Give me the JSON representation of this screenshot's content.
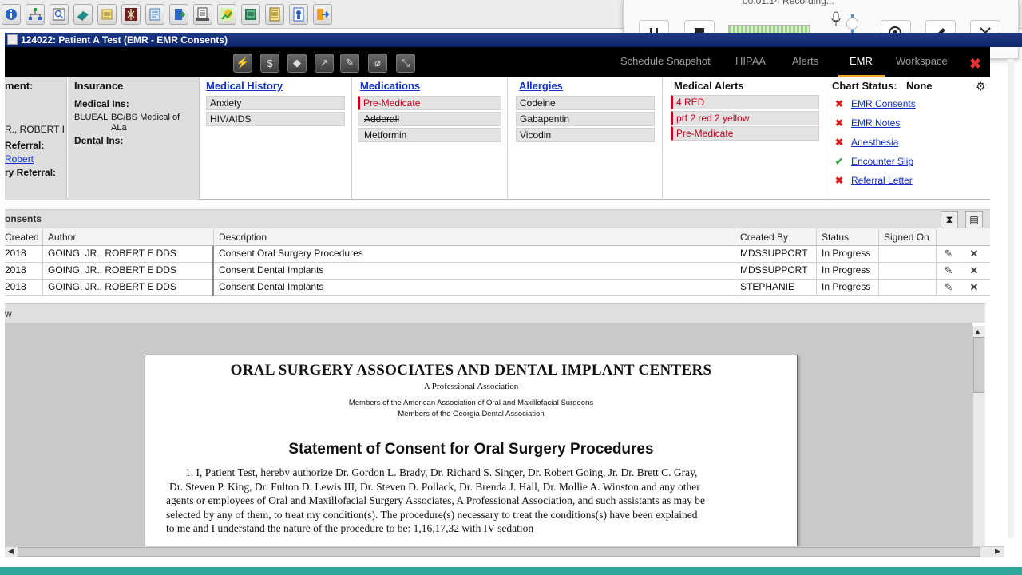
{
  "recorder": {
    "status": "00:01:14 Recording...",
    "buttons": [
      "pause-icon",
      "stop-icon",
      "webcam-icon",
      "pen-icon",
      "close-icon"
    ]
  },
  "toolbar_icons": [
    "info-icon",
    "org-chart-icon",
    "search-icon",
    "book-icon",
    "scroll-icon",
    "caduceus-icon",
    "form-icon",
    "exit-door-icon",
    "scanner-icon",
    "chart-icon",
    "ledger-icon",
    "binder-icon",
    "tooth-doc-icon",
    "logout-icon"
  ],
  "window": {
    "title": "124022: Patient A Test (EMR - EMR Consents)"
  },
  "nav": {
    "tabs": [
      {
        "label": "Schedule Snapshot"
      },
      {
        "label": "HIPAA"
      },
      {
        "label": "Alerts"
      },
      {
        "label": "EMR"
      },
      {
        "label": "Workspace"
      }
    ],
    "active_tab": "EMR",
    "accent_color": "#f2a52a"
  },
  "summary": {
    "left_partial": {
      "heading": "ment:",
      "doctor": "R., ROBERT I",
      "referral_label": "Referral:",
      "referral_link": "Robert",
      "secondary_referral_label": "ry Referral:"
    },
    "insurance": {
      "heading": "Insurance",
      "medical_label": "Medical Ins:",
      "medical_code": "BLUEAL",
      "medical_name_1": "BC/BS Medical of",
      "medical_name_2": "ALa",
      "dental_label": "Dental Ins:"
    },
    "medical_history": {
      "heading": "Medical History",
      "items": [
        "Anxiety",
        "HIV/AIDS"
      ]
    },
    "medications": {
      "heading": "Medications",
      "items": [
        "Pre-Medicate",
        "Adderall",
        "Metformin"
      ]
    },
    "allergies": {
      "heading": "Allergies",
      "items": [
        "Codeine",
        "Gabapentin",
        "Vicodin"
      ]
    },
    "medical_alerts": {
      "heading": "Medical Alerts",
      "items": [
        "4 RED",
        "prf 2 red 2 yellow",
        "Pre-Medicate"
      ]
    },
    "chart_status": {
      "label": "Chart Status:",
      "value": "None",
      "items": [
        {
          "mark": "✖",
          "label": "EMR Consents",
          "color": "#d81b1b"
        },
        {
          "mark": "✖",
          "label": "EMR Notes",
          "color": "#d81b1b"
        },
        {
          "mark": "✖",
          "label": "Anesthesia",
          "color": "#d81b1b"
        },
        {
          "mark": "✔",
          "label": "Encounter Slip",
          "color": "#2e9d3a"
        },
        {
          "mark": "✖",
          "label": "Referral Letter",
          "color": "#d81b1b"
        }
      ]
    }
  },
  "consents": {
    "heading": "onsents",
    "columns": [
      "Created",
      "Author",
      "Description",
      "Created By",
      "Status",
      "Signed On"
    ],
    "rows": [
      {
        "created": "2018",
        "author": "GOING, JR., ROBERT E DDS",
        "description": "Consent Oral Surgery Procedures",
        "created_by": "MDSSUPPORT",
        "status": "In Progress",
        "signed_on": ""
      },
      {
        "created": "2018",
        "author": "GOING, JR., ROBERT E DDS",
        "description": "Consent Dental Implants",
        "created_by": "MDSSUPPORT",
        "status": "In Progress",
        "signed_on": ""
      },
      {
        "created": "2018",
        "author": "GOING, JR., ROBERT E DDS",
        "description": "Consent Dental Implants",
        "created_by": "STEPHANIE",
        "status": "In Progress",
        "signed_on": ""
      }
    ]
  },
  "preview": {
    "heading": "w",
    "doc": {
      "org": "ORAL SURGERY ASSOCIATES AND DENTAL IMPLANT CENTERS",
      "sub": "A Professional Association",
      "member1": "Members of the American Association of Oral and Maxillofacial Surgeons",
      "member2": "Members of the Georgia Dental Association",
      "title": "Statement of Consent for Oral Surgery Procedures",
      "para": [
        "1.  I, Patient Test,  hereby authorize Dr. Gordon L. Brady, Dr. Richard S. Singer, Dr. Robert Going, Jr. Dr. Brett C. Gray,",
        "Dr. Steven P. King, Dr. Fulton D. Lewis III, Dr. Steven D. Pollack, Dr. Brenda J. Hall, Dr. Mollie A. Winston and any other",
        "agents or employees of Oral and Maxillofacial Surgery Associates, A Professional Association, and such assistants as may be",
        "selected by any of them, to treat my condition(s).   The procedure(s) necessary to treat the conditions(s) have been explained",
        "to me and I understand the nature of the procedure to be: 1,16,17,32  with IV sedation"
      ]
    }
  }
}
